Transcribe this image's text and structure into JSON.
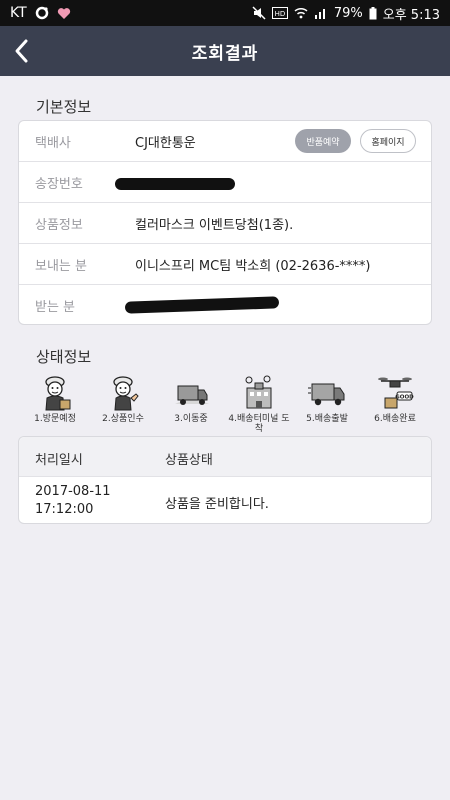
{
  "status_bar": {
    "carrier": "KT",
    "battery": "79%",
    "time": "오후 5:13"
  },
  "header": {
    "title": "조회결과"
  },
  "basic_info": {
    "section_title": "기본정보",
    "rows": [
      {
        "label": "택배사",
        "value": "CJ대한통운"
      },
      {
        "label": "송장번호",
        "value": ""
      },
      {
        "label": "상품정보",
        "value": "컬러마스크 이벤트당첨(1종)."
      },
      {
        "label": "보내는 분",
        "value": "이니스프리 MC팀 박소희 (02-2636-****)"
      },
      {
        "label": "받는 분",
        "value": ""
      }
    ],
    "reserve_return_label": "반품예약",
    "homepage_label": "홈페이지"
  },
  "status_info": {
    "section_title": "상태정보",
    "steps": [
      {
        "caption": "1.방문예정",
        "icon": "courier-worker-icon"
      },
      {
        "caption": "2.상품인수",
        "icon": "courier-thumbs-up-icon"
      },
      {
        "caption": "3.이동중",
        "icon": "moving-truck-icon"
      },
      {
        "caption": "4.배송터미널 도착",
        "icon": "terminal-building-icon"
      },
      {
        "caption": "5.배송출발",
        "icon": "delivery-truck-icon"
      },
      {
        "caption": "6.배송완료",
        "icon": "drone-good-icon"
      }
    ]
  },
  "process": {
    "headers": [
      "처리일시",
      "상품상태"
    ],
    "rows": [
      {
        "date": "2017-08-11",
        "time": "17:12:00",
        "status": "상품을 준비합니다."
      }
    ]
  },
  "colors": {
    "header_bg": "#3a4050",
    "page_bg": "#efeef3",
    "pill_dark": "#9fa2ab"
  }
}
